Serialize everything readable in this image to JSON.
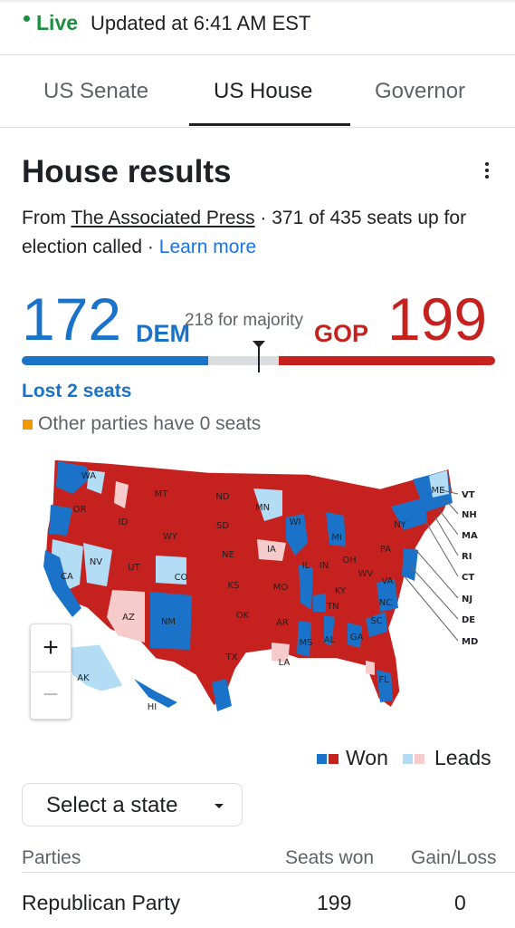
{
  "header": {
    "live_label": "Live",
    "updated_text": "Updated at 6:41 AM EST"
  },
  "tabs": [
    {
      "label": "US Senate",
      "active": false
    },
    {
      "label": "US House",
      "active": true
    },
    {
      "label": "Governor",
      "active": false
    }
  ],
  "results": {
    "title": "House results",
    "source_prefix": "From",
    "source_name": "The Associated Press",
    "source_suffix": "· 371 of 435 seats up for election called ·",
    "learn_more": "Learn more",
    "dem_seats": "172",
    "dem_label": "DEM",
    "majority_text": "218 for majority",
    "gop_label": "GOP",
    "gop_seats": "199",
    "dem_share": 172,
    "gop_share": 199,
    "total_seats": 435,
    "majority": 218,
    "lost_text": "Lost 2 seats",
    "other_text": "Other parties have 0 seats"
  },
  "colors": {
    "dem": "#1a73c8",
    "gop": "#c5221f",
    "dem_lead": "#b3dcf5",
    "gop_lead": "#f6cbcb",
    "other": "#f29900"
  },
  "map": {
    "states": [
      "WA",
      "OR",
      "ID",
      "MT",
      "ND",
      "SD",
      "WY",
      "MN",
      "WI",
      "MI",
      "NY",
      "ME",
      "NV",
      "CA",
      "UT",
      "CO",
      "NE",
      "IA",
      "IL",
      "IN",
      "OH",
      "PA",
      "KS",
      "MO",
      "KY",
      "WV",
      "VA",
      "AZ",
      "NM",
      "OK",
      "TN",
      "NC",
      "AR",
      "SC",
      "MS",
      "AL",
      "GA",
      "TX",
      "LA",
      "FL",
      "AK",
      "HI"
    ],
    "callouts": [
      "VT",
      "NH",
      "MA",
      "RI",
      "CT",
      "NJ",
      "DE",
      "MD"
    ],
    "zoom_in": "+",
    "zoom_out": "−"
  },
  "legend": {
    "won": "Won",
    "leads": "Leads"
  },
  "select": {
    "label": "Select a state"
  },
  "table": {
    "headers": [
      "Parties",
      "Seats won",
      "Gain/Loss"
    ],
    "rows": [
      {
        "party": "Republican Party",
        "seats": "199",
        "gain": "0"
      }
    ]
  }
}
